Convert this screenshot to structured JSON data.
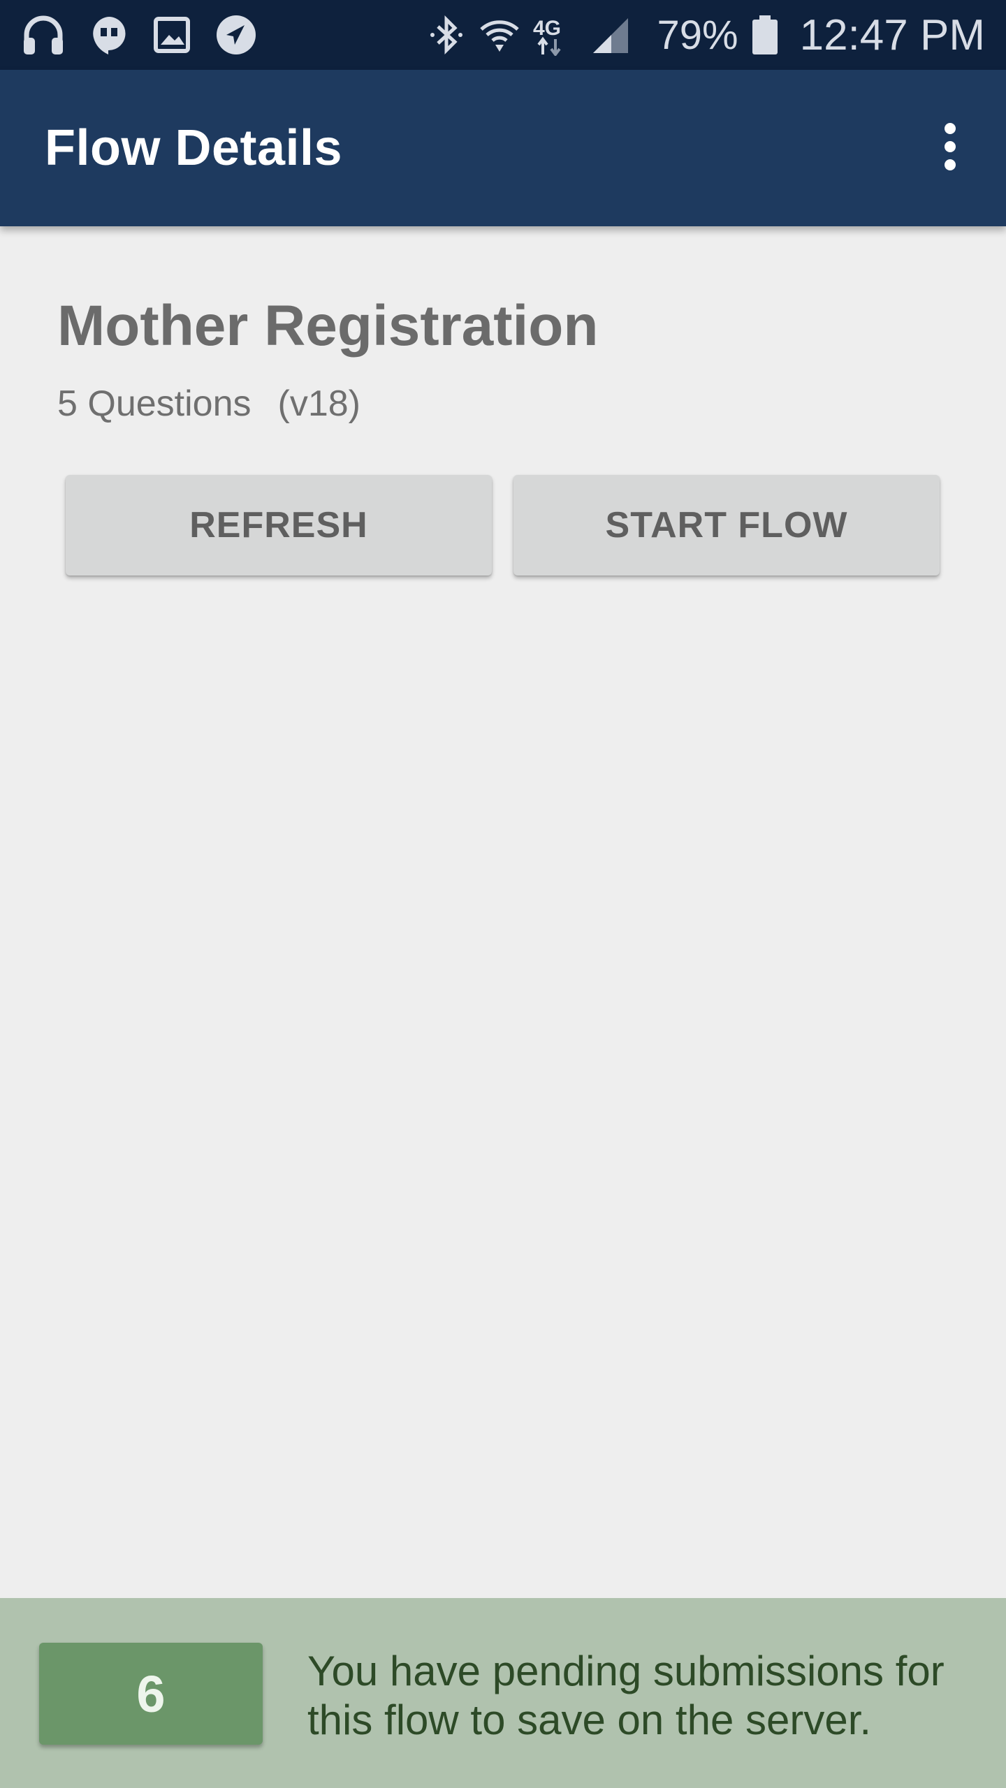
{
  "status_bar": {
    "left_icons": [
      "headphones-icon",
      "hangouts-icon",
      "gallery-icon",
      "telegram-icon"
    ],
    "right_icons": [
      "bluetooth-icon",
      "wifi-icon",
      "network-4g-lte-icon",
      "signal-icon"
    ],
    "battery_percent": "79%",
    "battery_icon": "battery-icon",
    "time": "12:47 PM"
  },
  "app_bar": {
    "title": "Flow Details",
    "overflow_icon": "more-vert-icon",
    "color": "#1e3a5f"
  },
  "flow": {
    "name": "Mother Registration",
    "questions": "5 Questions",
    "version": "(v18)"
  },
  "actions": {
    "refresh_label": "REFRESH",
    "start_label": "START FLOW"
  },
  "footer": {
    "pending_count": "6",
    "message": "You have pending submissions for this flow to save on the server.",
    "background": "#b0c2ae",
    "badge_color": "#6b9669"
  }
}
